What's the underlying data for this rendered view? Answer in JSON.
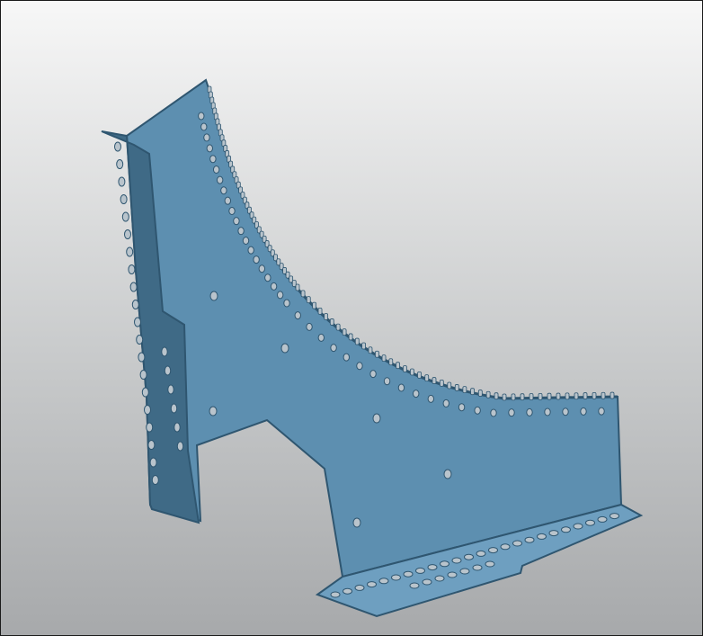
{
  "viewport": {
    "background_top": "#f7f7f7",
    "background_bottom": "#a7a9ab",
    "frame_color": "#1a1a1a"
  },
  "model": {
    "icon": "sheet-metal-bracket",
    "face_color": "#5d8fb0",
    "flange_color": "#6e9fc0",
    "edge_color": "#2f5670",
    "hole_color": "#b9c4cc",
    "shadow_color": "#3f6a86"
  }
}
